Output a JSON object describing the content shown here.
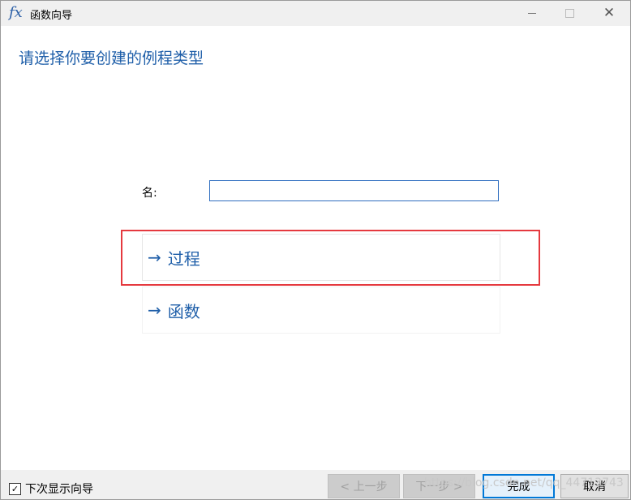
{
  "window": {
    "icon_text": "fx",
    "title": "函数向导",
    "close_glyph": "✕"
  },
  "main": {
    "heading": "请选择你要创建的例程类型",
    "name_label": "名:",
    "name_value": "",
    "options": [
      {
        "arrow": "→",
        "label": "过程"
      },
      {
        "arrow": "→",
        "label": "函数"
      }
    ]
  },
  "footer": {
    "checkbox_checked": true,
    "checkbox_mark": "✓",
    "checkbox_label": "下次显示向导",
    "prev_label": "< 上一步",
    "next_label": "下一步 >",
    "finish_label": "完成",
    "cancel_label": "取消"
  },
  "watermark": "https://blog.csdn.net/qq_44713743",
  "colors": {
    "accent": "#1f5fa9",
    "highlight_border": "#e5393f",
    "focus_border": "#0078d7"
  }
}
